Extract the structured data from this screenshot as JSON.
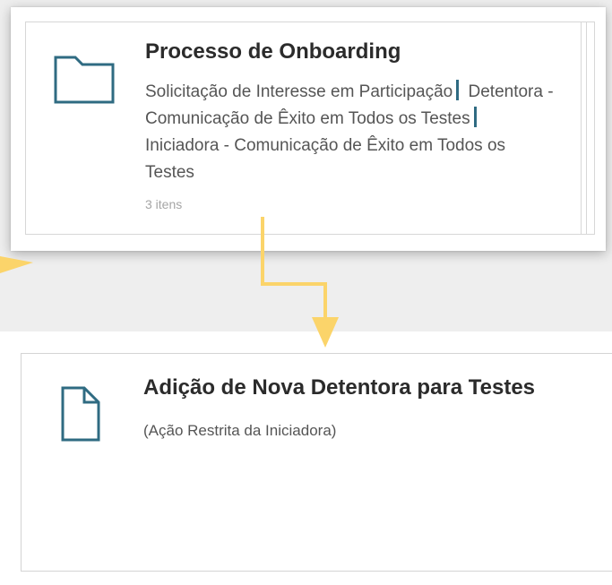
{
  "top_card": {
    "title": "Processo de Onboarding",
    "description_items": [
      "Solicitação de Interesse em Participação",
      "Detentora - Comunicação de Êxito em Todos os Testes",
      "Iniciadora - Comunicação de Êxito em Todos os Testes"
    ],
    "item_count": "3 itens",
    "icon": "folder-icon"
  },
  "bottom_card": {
    "title": "Adição de Nova Detentora para Testes",
    "subtitle": "(Ação Restrita da Iniciadora)",
    "icon": "document-icon"
  },
  "colors": {
    "icon_teal": "#2f6b82",
    "arrow_yellow": "#fbd46a",
    "title_text": "#2b2b2b",
    "body_text": "#555555",
    "count_text": "#a5a5a5",
    "background_grey": "#eeeeee"
  }
}
